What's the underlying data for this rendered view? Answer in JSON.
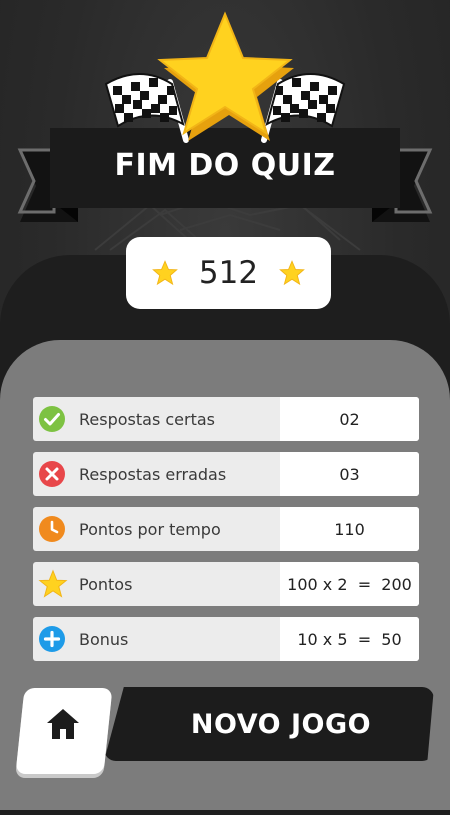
{
  "header": {
    "title": "FIM DO QUIZ"
  },
  "score": {
    "value": "512"
  },
  "results": [
    {
      "icon": "check-circle-icon",
      "label": "Respostas certas",
      "value": "02"
    },
    {
      "icon": "x-circle-icon",
      "label": "Respostas erradas",
      "value": "03"
    },
    {
      "icon": "clock-icon",
      "label": "Pontos por tempo",
      "value": "110"
    },
    {
      "icon": "star-icon",
      "label": "Pontos",
      "value": "100 x 2  =  200"
    },
    {
      "icon": "plus-circle-icon",
      "label": "Bonus",
      "value": "10 x 5  =  50"
    }
  ],
  "actions": {
    "home_icon": "home-icon",
    "new_game_label": "NOVO JOGO"
  },
  "colors": {
    "star": "#FFD21F",
    "check": "#7DC242",
    "wrong": "#E8474A",
    "clock": "#F08A1E",
    "bonus": "#1E9BE8"
  }
}
